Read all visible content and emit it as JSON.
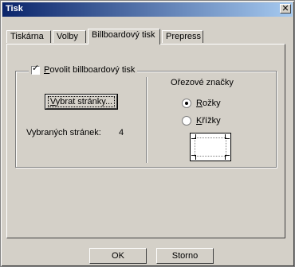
{
  "window": {
    "title": "Tisk",
    "close_glyph": "✕"
  },
  "tabs": [
    {
      "label": "Tiskárna"
    },
    {
      "label": "Volby"
    },
    {
      "label": "Billboardový tisk"
    },
    {
      "label": "Prepress"
    }
  ],
  "billboard": {
    "enable_label_mnemonic": "P",
    "enable_label_rest": "ovolit billboardový tisk",
    "enabled": true,
    "select_pages_mnemonic": "V",
    "select_pages_rest": "ybrat stránky...",
    "selected_pages_label": "Vybraných stránek:",
    "selected_pages_value": "4"
  },
  "crop_marks": {
    "title": "Ořezové značky",
    "option_corners_mnemonic": "R",
    "option_corners_rest": "ožky",
    "option_crosses_mnemonic": "K",
    "option_crosses_rest": "řížky",
    "selected": "corners"
  },
  "buttons": {
    "ok": "OK",
    "cancel": "Storno"
  }
}
